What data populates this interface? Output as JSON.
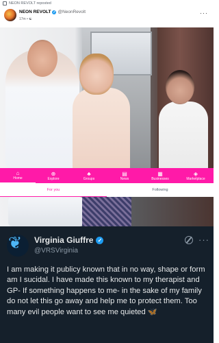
{
  "repost": {
    "text": "NEON REVOLT reposted"
  },
  "post": {
    "author_name": "NEON REVOLT",
    "author_handle": "@NeonRevolt",
    "meta": "17m • ☯",
    "more": "···"
  },
  "nav": {
    "items": [
      {
        "label": "Home",
        "icon": "⌂"
      },
      {
        "label": "Explore",
        "icon": "⊕"
      },
      {
        "label": "Groups",
        "icon": "♣"
      },
      {
        "label": "News",
        "icon": "▤"
      },
      {
        "label": "Businesses",
        "icon": "▦"
      },
      {
        "label": "Marketplace",
        "icon": "◈"
      }
    ],
    "active": "Home"
  },
  "tabs": {
    "items": [
      "For you",
      "Following"
    ],
    "active": "For you"
  },
  "tweet": {
    "name": "Virginia Giuffre",
    "handle": "@VRSVirginia",
    "verified_mark": "✓",
    "more": "···",
    "text": "I am making it publicy known that in no way, shape or form am I sucidal. I have made this known to my therapist and GP- If something happens to me- in the sake of my family do not let this go away and help me to protect them. Too many evil people want to see me quieted 🦋",
    "icon": "butterfly-icon",
    "bg_color": "#15202b",
    "accent_color": "#ff1aa8"
  }
}
